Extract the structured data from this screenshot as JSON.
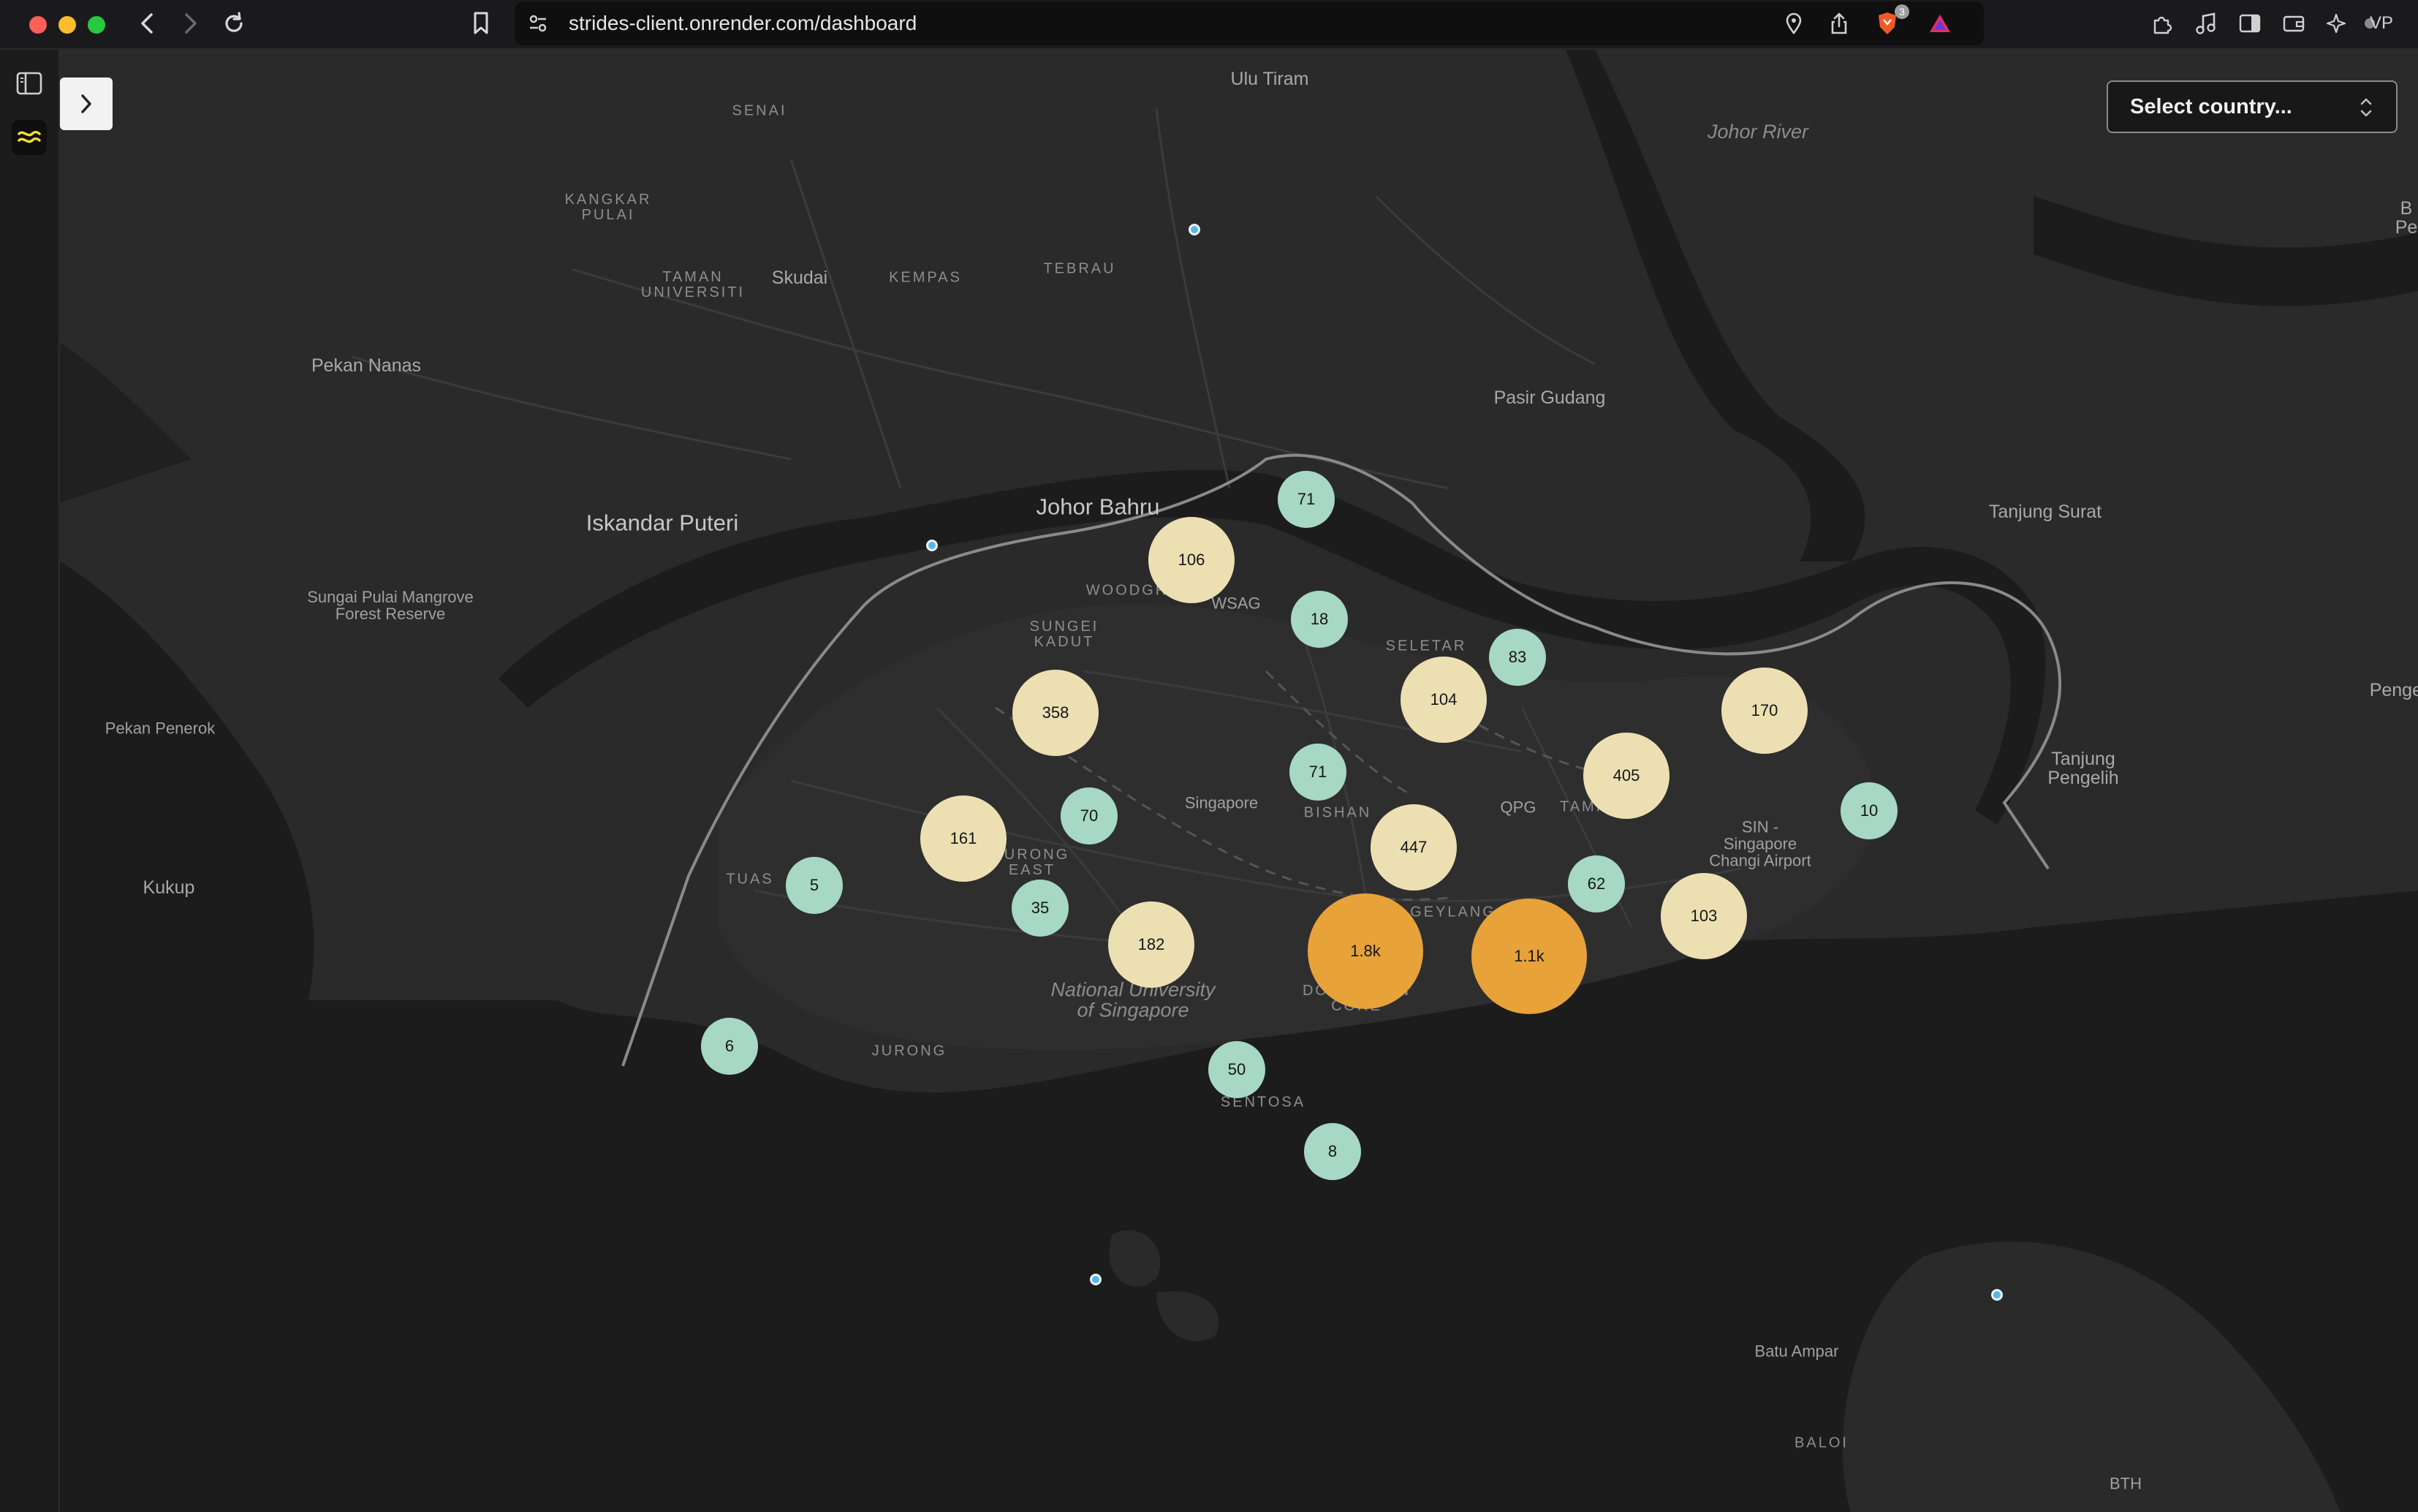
{
  "browser": {
    "url": "strides-client.onrender.com/dashboard",
    "shield_badge": "3",
    "vpn_label": "VP"
  },
  "map": {
    "country_select": {
      "placeholder": "Select country..."
    },
    "labels": [
      {
        "text": "Ulu Tiram",
        "style": "town"
      },
      {
        "text": "SENAI",
        "style": "caps"
      },
      {
        "text": "Johor River",
        "style": "water"
      },
      {
        "text": "KANGKAR\nPULAI",
        "style": "caps"
      },
      {
        "text": "TAMAN\nUNIVERSITI",
        "style": "caps"
      },
      {
        "text": "Skudai",
        "style": "town"
      },
      {
        "text": "KEMPAS",
        "style": "caps"
      },
      {
        "text": "TEBRAU",
        "style": "caps"
      },
      {
        "text": "Pekan Nanas",
        "style": "town"
      },
      {
        "text": "Pasir Gudang",
        "style": "town"
      },
      {
        "text": "Johor Bahru",
        "style": "city"
      },
      {
        "text": "Iskandar Puteri",
        "style": "city"
      },
      {
        "text": "Tanjung Surat",
        "style": "town"
      },
      {
        "text": "Sungai Pulai Mangrove\nForest Reserve",
        "style": "small"
      },
      {
        "text": "WOODGR",
        "style": "caps"
      },
      {
        "text": "WSAG",
        "style": "small"
      },
      {
        "text": "SUNGEI\nKADUT",
        "style": "caps"
      },
      {
        "text": "SELETAR",
        "style": "caps"
      },
      {
        "text": "Pekan Penerok",
        "style": "small"
      },
      {
        "text": "Penger",
        "style": "town"
      },
      {
        "text": "Tanjung\nPengelih",
        "style": "town"
      },
      {
        "text": "Singapore",
        "style": "small"
      },
      {
        "text": "BISHAN",
        "style": "caps"
      },
      {
        "text": "QPG",
        "style": "small"
      },
      {
        "text": "TAMP",
        "style": "caps"
      },
      {
        "text": "SIN -\nSingapore\nChangi Airport",
        "style": "small"
      },
      {
        "text": "JURONG\nEAST",
        "style": "caps"
      },
      {
        "text": "TUAS",
        "style": "caps"
      },
      {
        "text": "Kukup",
        "style": "town"
      },
      {
        "text": "GEYLANG",
        "style": "caps"
      },
      {
        "text": "National University\nof Singapore",
        "style": "water"
      },
      {
        "text": "DOWNTOWN\nCORE",
        "style": "caps"
      },
      {
        "text": "JURONG",
        "style": "caps"
      },
      {
        "text": "SENTOSA",
        "style": "caps"
      },
      {
        "text": "Batu Ampar",
        "style": "small"
      },
      {
        "text": "BALOI",
        "style": "caps"
      },
      {
        "text": "BTH",
        "style": "small"
      },
      {
        "text": "B\nPe",
        "style": "town"
      }
    ],
    "clusters": [
      {
        "label": "71",
        "count": 71,
        "tier": "low"
      },
      {
        "label": "106",
        "count": 106,
        "tier": "mid"
      },
      {
        "label": "18",
        "count": 18,
        "tier": "low"
      },
      {
        "label": "83",
        "count": 83,
        "tier": "low"
      },
      {
        "label": "104",
        "count": 104,
        "tier": "mid"
      },
      {
        "label": "170",
        "count": 170,
        "tier": "mid"
      },
      {
        "label": "358",
        "count": 358,
        "tier": "mid"
      },
      {
        "label": "71",
        "count": 71,
        "tier": "low"
      },
      {
        "label": "405",
        "count": 405,
        "tier": "mid"
      },
      {
        "label": "70",
        "count": 70,
        "tier": "low"
      },
      {
        "label": "10",
        "count": 10,
        "tier": "low"
      },
      {
        "label": "161",
        "count": 161,
        "tier": "mid"
      },
      {
        "label": "447",
        "count": 447,
        "tier": "mid"
      },
      {
        "label": "62",
        "count": 62,
        "tier": "low"
      },
      {
        "label": "5",
        "count": 5,
        "tier": "low"
      },
      {
        "label": "35",
        "count": 35,
        "tier": "low"
      },
      {
        "label": "103",
        "count": 103,
        "tier": "mid"
      },
      {
        "label": "182",
        "count": 182,
        "tier": "mid"
      },
      {
        "label": "1.8k",
        "count": 1800,
        "tier": "high"
      },
      {
        "label": "1.1k",
        "count": 1100,
        "tier": "high"
      },
      {
        "label": "6",
        "count": 6,
        "tier": "low"
      },
      {
        "label": "50",
        "count": 50,
        "tier": "low"
      },
      {
        "label": "8",
        "count": 8,
        "tier": "low"
      }
    ],
    "tier_colors": {
      "low": "#a7d7c5",
      "mid": "#ece0b3",
      "high": "#e8a23a"
    }
  }
}
